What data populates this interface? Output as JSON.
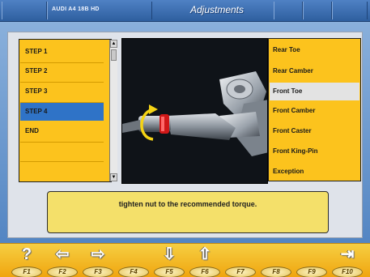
{
  "header": {
    "vehicle": "AUDI A4 18B HD",
    "title": "Adjustments"
  },
  "steps": [
    {
      "label": "STEP 1"
    },
    {
      "label": "STEP 2"
    },
    {
      "label": "STEP 3"
    },
    {
      "label": "STEP 4"
    },
    {
      "label": "END"
    }
  ],
  "selected_step": "STEP 4",
  "checks": [
    {
      "label": "Rear Toe"
    },
    {
      "label": "Rear Camber"
    },
    {
      "label": "Front Toe"
    },
    {
      "label": "Front Camber"
    },
    {
      "label": "Front Caster"
    },
    {
      "label": "Front King-Pin"
    },
    {
      "label": "Exception"
    }
  ],
  "selected_check": "Front Toe",
  "instruction": "tighten nut to the recommended torque.",
  "fkeys": [
    {
      "label": "F1",
      "icon": "help-icon",
      "symbol": "?"
    },
    {
      "label": "F2",
      "icon": "arrow-left-icon",
      "symbol": "⇦"
    },
    {
      "label": "F3",
      "icon": "arrow-right-icon",
      "symbol": "⇨"
    },
    {
      "label": "F4",
      "icon": "",
      "symbol": ""
    },
    {
      "label": "F5",
      "icon": "list-down-icon",
      "symbol": "⇩"
    },
    {
      "label": "F6",
      "icon": "list-up-icon",
      "symbol": "⇧"
    },
    {
      "label": "F7",
      "icon": "",
      "symbol": ""
    },
    {
      "label": "F8",
      "icon": "",
      "symbol": ""
    },
    {
      "label": "F9",
      "icon": "",
      "symbol": ""
    },
    {
      "label": "F10",
      "icon": "exit-icon",
      "symbol": "⇥"
    }
  ],
  "colors": {
    "panel_yellow": "#fcc31d",
    "selection_blue": "#2f73c7",
    "title_blue": "#2e5f9f"
  }
}
